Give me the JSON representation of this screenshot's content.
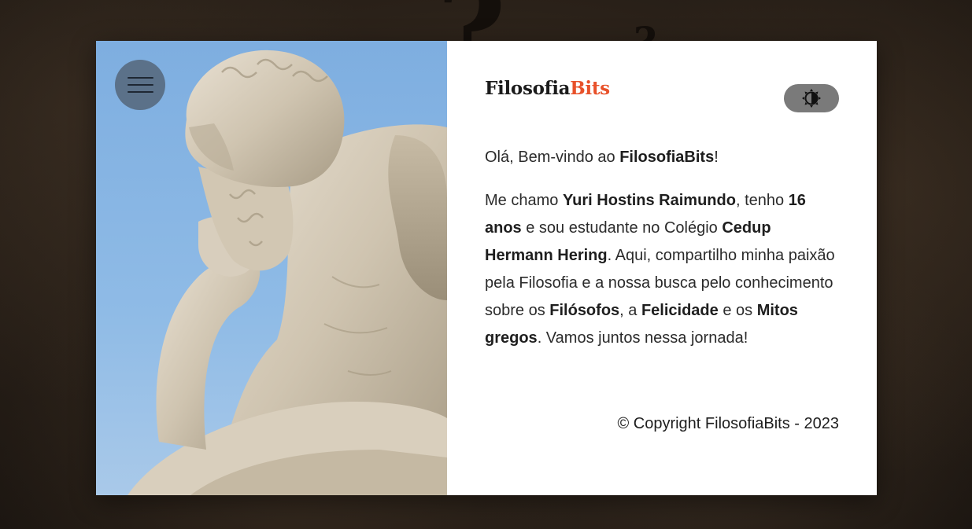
{
  "menu": {
    "icon": "hamburger-icon"
  },
  "brand": {
    "name_part1": "Filosofia",
    "name_part2": "Bits",
    "accent_color": "#e8512a"
  },
  "theme_toggle": {
    "icon": "contrast-icon"
  },
  "welcome": {
    "prefix": "Olá, Bem-vindo ao ",
    "site_name": "FilosofiaBits",
    "suffix": "!"
  },
  "about": {
    "t1": "Me chamo ",
    "name": "Yuri Hostins Raimundo",
    "t2": ", tenho ",
    "age": "16 anos",
    "t3": " e sou estudante no Colégio ",
    "school": "Cedup Hermann Hering",
    "t4": ". Aqui, compartilho minha paixão pela Filosofia e a nossa busca pelo conhecimento sobre os ",
    "topic1": "Filósofos",
    "t5": ", a ",
    "topic2": "Felicidade",
    "t6": " e os ",
    "topic3": "Mitos gregos",
    "t7": ". Vamos juntos nessa jornada!"
  },
  "footer": {
    "copyright": "© Copyright FilosofiaBits - 2023"
  },
  "colors": {
    "menu_button_bg": "#5b7189",
    "toggle_bg": "#7a7a7a",
    "sky": "#7eaee0"
  }
}
